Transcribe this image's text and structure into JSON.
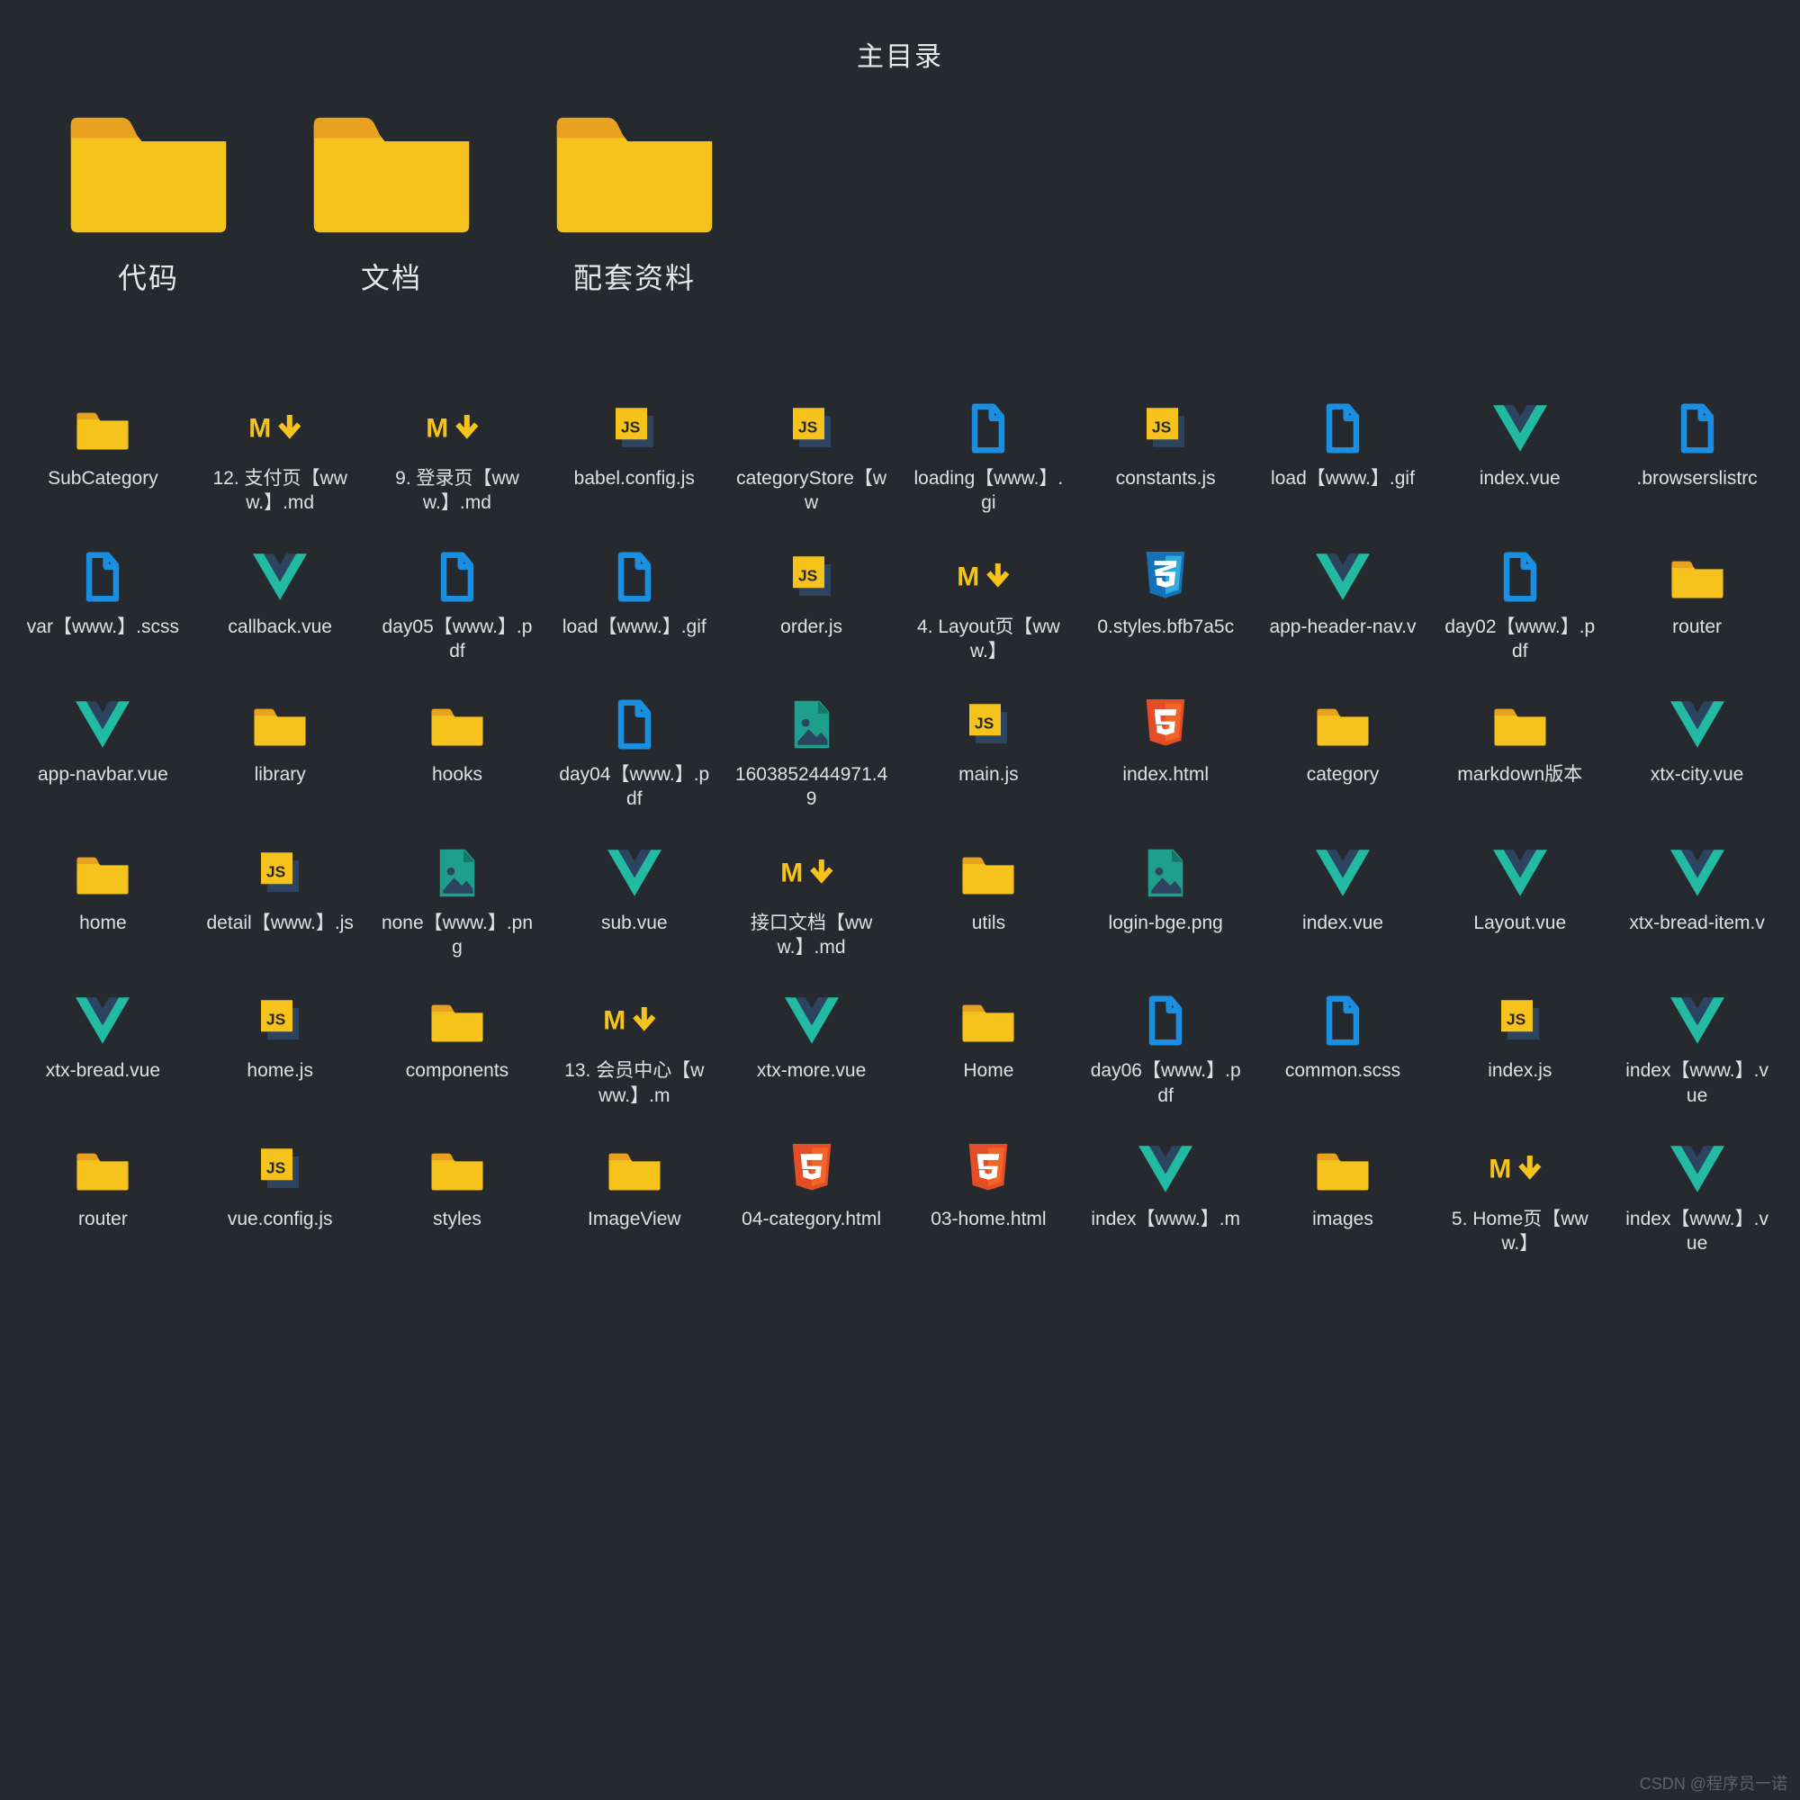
{
  "title": "主目录",
  "watermark": "CSDN @程序员一诺",
  "colors": {
    "folder_body": "#f6c31c",
    "folder_tab": "#e9a220",
    "js_bg": "#f6c31c",
    "js_text": "#2a2a2a",
    "file_blue": "#1a8ee0",
    "vue_green": "#22baa3",
    "vue_dark": "#2d4460",
    "md_yellow": "#f6c31c",
    "html_orange": "#e44d26",
    "css_blue": "#1572b6",
    "image_teal": "#1e9e8c"
  },
  "top_folders": [
    {
      "label": "代码"
    },
    {
      "label": "文档"
    },
    {
      "label": "配套资料"
    }
  ],
  "items": [
    {
      "icon": "folder",
      "label": "SubCategory"
    },
    {
      "icon": "md",
      "label": "12. 支付页【www.】.md"
    },
    {
      "icon": "md",
      "label": "9. 登录页【www.】.md"
    },
    {
      "icon": "js",
      "label": "babel.config.js"
    },
    {
      "icon": "js",
      "label": "categoryStore【ww"
    },
    {
      "icon": "file-blue",
      "label": "loading【www.】.gi"
    },
    {
      "icon": "js",
      "label": "constants.js"
    },
    {
      "icon": "file-blue",
      "label": "load【www.】.gif"
    },
    {
      "icon": "vue",
      "label": "index.vue"
    },
    {
      "icon": "file-blue",
      "label": ".browserslistrc"
    },
    {
      "icon": "file-blue",
      "label": "var【www.】.scss"
    },
    {
      "icon": "vue",
      "label": "callback.vue"
    },
    {
      "icon": "file-blue",
      "label": "day05【www.】.pdf"
    },
    {
      "icon": "file-blue",
      "label": "load【www.】.gif"
    },
    {
      "icon": "js",
      "label": "order.js"
    },
    {
      "icon": "md",
      "label": "4. Layout页【www.】"
    },
    {
      "icon": "css",
      "label": "0.styles.bfb7a5c"
    },
    {
      "icon": "vue",
      "label": "app-header-nav.v"
    },
    {
      "icon": "file-blue",
      "label": "day02【www.】.pdf"
    },
    {
      "icon": "folder",
      "label": "router"
    },
    {
      "icon": "vue",
      "label": "app-navbar.vue"
    },
    {
      "icon": "folder",
      "label": "library"
    },
    {
      "icon": "folder",
      "label": "hooks"
    },
    {
      "icon": "file-blue",
      "label": "day04【www.】.pdf"
    },
    {
      "icon": "image",
      "label": "1603852444971.49"
    },
    {
      "icon": "js",
      "label": "main.js"
    },
    {
      "icon": "html",
      "label": "index.html"
    },
    {
      "icon": "folder",
      "label": "category"
    },
    {
      "icon": "folder",
      "label": "markdown版本"
    },
    {
      "icon": "vue",
      "label": "xtx-city.vue"
    },
    {
      "icon": "folder",
      "label": "home"
    },
    {
      "icon": "js",
      "label": "detail【www.】.js"
    },
    {
      "icon": "image",
      "label": "none【www.】.png"
    },
    {
      "icon": "vue",
      "label": "sub.vue"
    },
    {
      "icon": "md",
      "label": "接口文档【www.】.md"
    },
    {
      "icon": "folder",
      "label": "utils"
    },
    {
      "icon": "image",
      "label": "login-bge.png"
    },
    {
      "icon": "vue",
      "label": "index.vue"
    },
    {
      "icon": "vue",
      "label": "Layout.vue"
    },
    {
      "icon": "vue",
      "label": "xtx-bread-item.v"
    },
    {
      "icon": "vue",
      "label": "xtx-bread.vue"
    },
    {
      "icon": "js",
      "label": "home.js"
    },
    {
      "icon": "folder",
      "label": "components"
    },
    {
      "icon": "md",
      "label": "13. 会员中心【www.】.m"
    },
    {
      "icon": "vue",
      "label": "xtx-more.vue"
    },
    {
      "icon": "folder",
      "label": "Home"
    },
    {
      "icon": "file-blue",
      "label": "day06【www.】.pdf"
    },
    {
      "icon": "file-blue",
      "label": "common.scss"
    },
    {
      "icon": "js",
      "label": "index.js"
    },
    {
      "icon": "vue",
      "label": "index【www.】.vue"
    },
    {
      "icon": "folder",
      "label": "router"
    },
    {
      "icon": "js",
      "label": "vue.config.js"
    },
    {
      "icon": "folder",
      "label": "styles"
    },
    {
      "icon": "folder",
      "label": "ImageView"
    },
    {
      "icon": "html",
      "label": "04-category.html"
    },
    {
      "icon": "html",
      "label": "03-home.html"
    },
    {
      "icon": "vue",
      "label": "index【www.】.m"
    },
    {
      "icon": "folder",
      "label": "images"
    },
    {
      "icon": "md",
      "label": "5. Home页【www.】"
    },
    {
      "icon": "vue",
      "label": "index【www.】.vue"
    }
  ]
}
